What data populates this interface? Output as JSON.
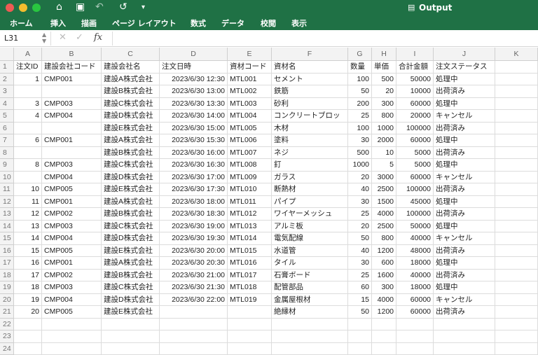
{
  "window": {
    "title": "Output",
    "colors": {
      "brand": "#1f7145",
      "close": "#ee5b54",
      "minimize": "#f3bd2e",
      "zoom": "#29c640"
    }
  },
  "toolbar": {
    "icons": [
      "home-icon",
      "save-icon",
      "undo-icon",
      "redo-icon",
      "customize-icon"
    ]
  },
  "ribbon": {
    "tabs": [
      "ホーム",
      "挿入",
      "描画",
      "ページ レイアウト",
      "数式",
      "データ",
      "校閲",
      "表示"
    ]
  },
  "formula_bar": {
    "name_box": "L31",
    "fx": "fx",
    "value": ""
  },
  "columns": [
    "A",
    "B",
    "C",
    "D",
    "E",
    "F",
    "G",
    "H",
    "I",
    "J",
    "K"
  ],
  "rows": [
    [
      "注文ID",
      "建設会社コード",
      "建設会社名",
      "注文日時",
      "資材コード",
      "資材名",
      "数量",
      "単価",
      "合計金額",
      "注文ステータス",
      ""
    ],
    [
      "1",
      "CMP001",
      "建設A株式会社",
      "2023/6/30 12:30",
      "MTL001",
      "セメント",
      "100",
      "500",
      "50000",
      "処理中",
      ""
    ],
    [
      "",
      "",
      "建設B株式会社",
      "2023/6/30 13:00",
      "MTL002",
      "鉄筋",
      "50",
      "20",
      "10000",
      "出荷済み",
      ""
    ],
    [
      "3",
      "CMP003",
      "建設C株式会社",
      "2023/6/30 13:30",
      "MTL003",
      "砂利",
      "200",
      "300",
      "60000",
      "処理中",
      ""
    ],
    [
      "4",
      "CMP004",
      "建設D株式会社",
      "2023/6/30 14:00",
      "MTL004",
      "コンクリートブロッ",
      "25",
      "800",
      "20000",
      "キャンセル",
      ""
    ],
    [
      "",
      "",
      "建設E株式会社",
      "2023/6/30 15:00",
      "MTL005",
      "木材",
      "100",
      "1000",
      "100000",
      "出荷済み",
      ""
    ],
    [
      "6",
      "CMP001",
      "建設A株式会社",
      "2023/6/30 15:30",
      "MTL006",
      "塗料",
      "30",
      "2000",
      "60000",
      "処理中",
      ""
    ],
    [
      "",
      "",
      "建設B株式会社",
      "2023/6/30 16:00",
      "MTL007",
      "ネジ",
      "500",
      "10",
      "5000",
      "出荷済み",
      ""
    ],
    [
      "8",
      "CMP003",
      "建設C株式会社",
      "2023/6/30 16:30",
      "MTL008",
      "釘",
      "1000",
      "5",
      "5000",
      "処理中",
      ""
    ],
    [
      "",
      "CMP004",
      "建設D株式会社",
      "2023/6/30 17:00",
      "MTL009",
      "ガラス",
      "20",
      "3000",
      "60000",
      "キャンセル",
      ""
    ],
    [
      "10",
      "CMP005",
      "建設E株式会社",
      "2023/6/30 17:30",
      "MTL010",
      "断熱材",
      "40",
      "2500",
      "100000",
      "出荷済み",
      ""
    ],
    [
      "11",
      "CMP001",
      "建設A株式会社",
      "2023/6/30 18:00",
      "MTL011",
      "パイプ",
      "30",
      "1500",
      "45000",
      "処理中",
      ""
    ],
    [
      "12",
      "CMP002",
      "建設B株式会社",
      "2023/6/30 18:30",
      "MTL012",
      "ワイヤーメッシュ",
      "25",
      "4000",
      "100000",
      "出荷済み",
      ""
    ],
    [
      "13",
      "CMP003",
      "建設C株式会社",
      "2023/6/30 19:00",
      "MTL013",
      "アルミ板",
      "20",
      "2500",
      "50000",
      "処理中",
      ""
    ],
    [
      "14",
      "CMP004",
      "建設D株式会社",
      "2023/6/30 19:30",
      "MTL014",
      "電気配線",
      "50",
      "800",
      "40000",
      "キャンセル",
      ""
    ],
    [
      "15",
      "CMP005",
      "建設E株式会社",
      "2023/6/30 20:00",
      "MTL015",
      "水道管",
      "40",
      "1200",
      "48000",
      "出荷済み",
      ""
    ],
    [
      "16",
      "CMP001",
      "建設A株式会社",
      "2023/6/30 20:30",
      "MTL016",
      "タイル",
      "30",
      "600",
      "18000",
      "処理中",
      ""
    ],
    [
      "17",
      "CMP002",
      "建設B株式会社",
      "2023/6/30 21:00",
      "MTL017",
      "石膏ボード",
      "25",
      "1600",
      "40000",
      "出荷済み",
      ""
    ],
    [
      "18",
      "CMP003",
      "建設C株式会社",
      "2023/6/30 21:30",
      "MTL018",
      "配管部品",
      "60",
      "300",
      "18000",
      "処理中",
      ""
    ],
    [
      "19",
      "CMP004",
      "建設D株式会社",
      "2023/6/30 22:00",
      "MTL019",
      "金属屋根材",
      "15",
      "4000",
      "60000",
      "キャンセル",
      ""
    ],
    [
      "20",
      "CMP005",
      "建設E株式会社",
      "",
      "",
      "絶縁材",
      "50",
      "1200",
      "60000",
      "出荷済み",
      ""
    ],
    [
      "",
      "",
      "",
      "",
      "",
      "",
      "",
      "",
      "",
      "",
      ""
    ],
    [
      "",
      "",
      "",
      "",
      "",
      "",
      "",
      "",
      "",
      "",
      ""
    ],
    [
      "",
      "",
      "",
      "",
      "",
      "",
      "",
      "",
      "",
      "",
      ""
    ]
  ]
}
